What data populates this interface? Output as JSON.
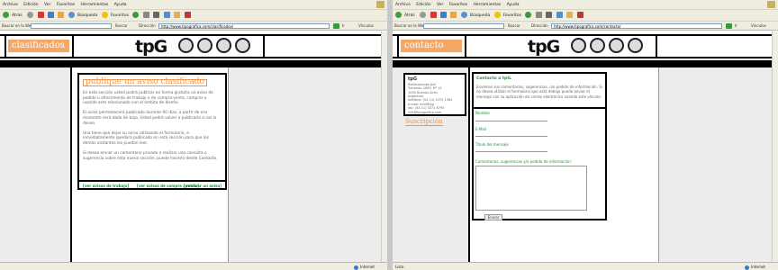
{
  "browser": {
    "menu": [
      "Archivo",
      "Edición",
      "Ver",
      "Favoritos",
      "Herramientas",
      "Ayuda"
    ],
    "toolbar": {
      "back": "Atrás",
      "search": "Búsqueda",
      "favorites": "Favoritos"
    },
    "address": {
      "search_label": "Buscar en la Web",
      "search_btn": "Buscar",
      "address_label": "Dirección",
      "go_label": "Ir",
      "links_label": "Vínculos"
    }
  },
  "left": {
    "url": "http://www.tipografica.com/clasificados/",
    "section": "clasificados",
    "logo": "tpG",
    "heading": "publique un aviso clasificado",
    "paragraphs": [
      "En esta sección usted podrá publicar en forma gratuita un aviso de pedido u ofrecimiento de trabajo o de compra-venta, comprar o usando este relacionado con el ámbito de diseño.",
      "El aviso permanecerá publicado durante 60 días, a partir de ese momento será dado de baja. Usted podrá volver a publicarlo si así lo desea.",
      "Una tiene que dejar su aviso utilizando el formulario, e inmediatamente quedará publicado en esta sección para que los demás visitantes los puedan leer.",
      "Si desea enviar un comentario privado o realizar una consulta o sugerencia sobre esta nueva sección, puede hacerlo desde Contacto."
    ],
    "links": [
      "[ver avisos de trabajo]",
      "[ver avisos de compra / venta]",
      "[publicar un aviso]"
    ],
    "status": "",
    "zone": "Internet"
  },
  "right": {
    "url": "http://www.tipografica.com/contacto/",
    "section": "contacto",
    "logo": "tpG",
    "sidebar_title": "tpG",
    "sidebar_lines": [
      "Publicaciones tpG",
      "Tucumán 1890, 6º 12",
      "1050 Buenos Aires",
      "Argentina",
      "teléfono: (54 11) 4372 1364",
      "e-mail: info@tpg",
      "fax: (54 11) 4371 6793",
      "info@tipografica.com"
    ],
    "suscription": "Suscripción",
    "intro_title": "Contacto a tpG.",
    "intro_text": "Envíenos sus comentarios, sugerencias, o/o pedido de información. Si no desea utilizar el formulario que está debajo puede enviar el mensaje con su aplicación de correo electrónico usando este vínculo.",
    "fields": [
      "Nombre",
      "E-Mail",
      "Título del mensaje",
      "Comentarios, sugerencias y/o pedido de información:"
    ],
    "send": "Enviar",
    "status": "Listo",
    "zone": "Internet"
  }
}
